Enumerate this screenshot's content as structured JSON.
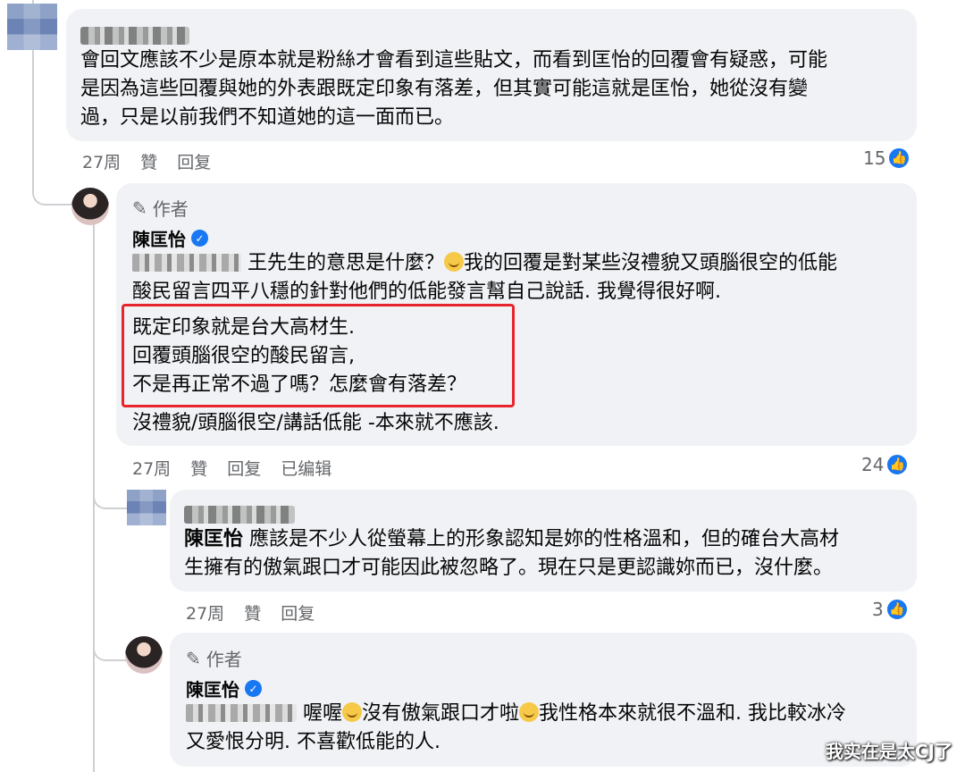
{
  "comments": [
    {
      "lines": [
        "會回文應該不少是原本就是粉絲才會看到這些貼文，而看到匡怡的回覆會有疑惑，可能",
        "是因為這些回覆與她的外表跟既定印象有落差，但其實可能這就是匡怡，她從沒有變",
        "過，只是以前我們不知道她的這一面而已。"
      ],
      "time": "27周",
      "like": "贊",
      "reply": "回复",
      "count": "15"
    },
    {
      "author_tag": "作者",
      "name": "陳匡怡",
      "line1_after_mention": "王先生的意思是什麼？",
      "line1_after_emoji": "我的回覆是對某些沒禮貌又頭腦很空的低能",
      "line2": "酸民留言四平八穩的針對他們的低能發言幫自己說話. 我覺得很好啊.",
      "highlight_lines": [
        "既定印象就是台大高材生.",
        "回覆頭腦很空的酸民留言,",
        "不是再正常不過了嗎？怎麼會有落差？"
      ],
      "last_line": "沒禮貌/頭腦很空/講話低能 -本來就不應該.",
      "time": "27周",
      "like": "贊",
      "reply": "回复",
      "edited": "已编辑",
      "count": "24"
    },
    {
      "mention": "陳匡怡",
      "line1": "應該是不少人從螢幕上的形象認知是妳的性格溫和，但的確台大高材",
      "line2": "生擁有的傲氣跟口才可能因此被忽略了。現在只是更認識妳而已，沒什麼。",
      "time": "27周",
      "like": "贊",
      "reply": "回复",
      "count": "3"
    },
    {
      "author_tag": "作者",
      "name": "陳匡怡",
      "line1_a": "喔喔",
      "line1_b": "沒有傲氣跟口才啦",
      "line1_c": "我性格本來就很不溫和. 我比較冰冷",
      "line2": "又愛恨分明. 不喜歡低能的人."
    }
  ],
  "watermark": "我实在是太CJ了",
  "colors": {
    "bubble": "#f0f2f5",
    "meta": "#65676b",
    "accent": "#1877f2",
    "highlight": "#e8242c"
  },
  "icons": {
    "author_tag": "pencil-icon",
    "verified": "verified-badge-icon",
    "like": "like-thumb-icon",
    "emoji_grin": "grinning-emoji-icon",
    "emoji_smile": "smile-emoji-icon"
  }
}
